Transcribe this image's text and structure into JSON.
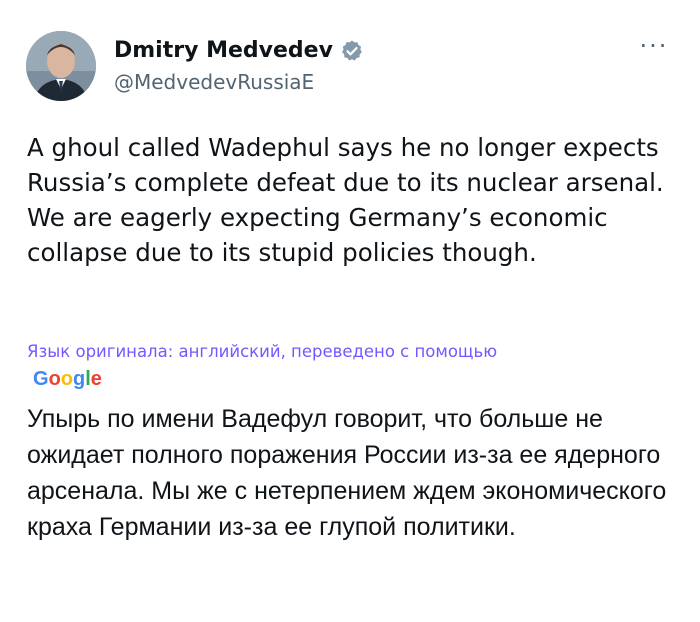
{
  "author": {
    "name": "Dmitry Medvedev",
    "handle": "@MedvedevRussiaE",
    "verified": true,
    "avatar_icon": "profile-photo"
  },
  "more_icon": "more-dots-icon",
  "more_label": "···",
  "tweet": {
    "text": "A ghoul called Wadephul says he no longer expects Russia’s complete defeat due to its nuclear arsenal. We are eagerly expecting Germany’s economic collapse due to its stupid policies though."
  },
  "translation": {
    "note": "Язык оригинала: английский, переведено с помощью",
    "provider": "Google",
    "text": "Упырь по имени Вадефул говорит, что больше не ожидает полного поражения России из-за ее ядерного арсенала. Мы же с нетерпением ждем экономического краха Германии из-за ее глупой политики."
  },
  "colors": {
    "text": "#0f1419",
    "secondary": "#536471",
    "verified": "#829aab",
    "translation_note": "#7856ff"
  }
}
